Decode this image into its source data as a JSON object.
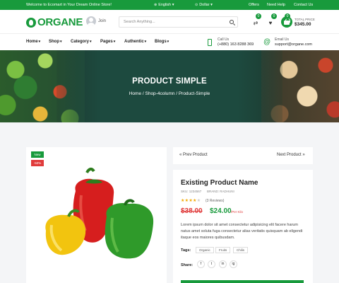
{
  "topbar": {
    "welcome": "Welcome to Ecomart in Your Dream Online Store!",
    "language": "English",
    "currency": "Dollar",
    "links": [
      "Offers",
      "Need Help",
      "Contact Us"
    ]
  },
  "header": {
    "logo": "ORGANE",
    "join": "Join",
    "search_placeholder": "Search Anything...",
    "badges": [
      "0",
      "0",
      "0"
    ],
    "total_label": "TOTAL PRICE",
    "total_value": "$345.00"
  },
  "nav": {
    "items": [
      "Home",
      "Shop",
      "Category",
      "Pages",
      "Authentic",
      "Blogs"
    ],
    "call_label": "Call Us",
    "call_value": "(+880) 163 8288 369",
    "email_label": "Email Us",
    "email_value": "support@organe.com"
  },
  "hero": {
    "title": "PRODUCT SIMPLE",
    "crumbs": "Home / Shop-4column / Product-Simple"
  },
  "product": {
    "tag_new": "New",
    "tag_off": "-50%",
    "prev": "« Prev Product",
    "next": "Next Product »",
    "name": "Existing Product Name",
    "sku": "SKU: 1234567",
    "brand": "BRAND: RADHUNI",
    "rating": 4,
    "stars_on": "★★★★",
    "stars_off": "★",
    "reviews": "(3 Reviews)",
    "old_price": "$38.00",
    "new_price": "$24.00",
    "per": "/Per Kilo",
    "description": "Lorem ipsum dolor sit amet consectetur adipisicing elit facere harum natus amet soluta fuga consectetur alias veritatis quisquam ab eligendi itaque eos maiores quibusdam.",
    "tags_label": "Tags:",
    "tags": [
      "Organic",
      "Fruits",
      "Chilis"
    ],
    "share_label": "Share:",
    "share_icons": [
      "f",
      "t",
      "in",
      "ig"
    ]
  },
  "colors": {
    "brand": "#189a3c",
    "sale": "#e03b3b"
  }
}
